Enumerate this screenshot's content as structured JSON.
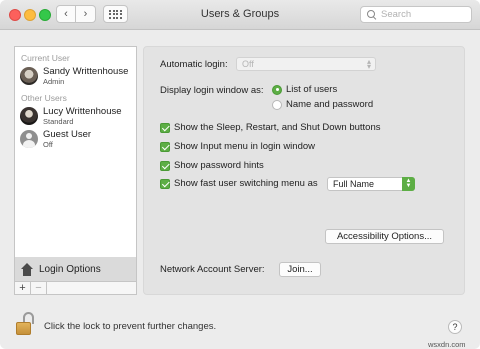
{
  "window": {
    "title": "Users & Groups"
  },
  "toolbar": {
    "back_glyph": "‹",
    "forward_glyph": "›"
  },
  "search": {
    "placeholder": "Search",
    "value": ""
  },
  "sidebar": {
    "current_header": "Current User",
    "other_header": "Other Users",
    "users": [
      {
        "name": "Sandy Writtenhouse",
        "role": "Admin",
        "avatar": "user-photo-avatar"
      },
      {
        "name": "Lucy Writtenhouse",
        "role": "Standard",
        "avatar": "user-photo-avatar"
      },
      {
        "name": "Guest User",
        "role": "Off",
        "avatar": "guest-silhouette-icon"
      }
    ],
    "login_options_label": "Login Options",
    "add_label": "+",
    "remove_label": "−"
  },
  "panel": {
    "auto_login_label": "Automatic login:",
    "auto_login_value": "Off",
    "display_login_label": "Display login window as:",
    "radio_list_label": "List of users",
    "radio_name_label": "Name and password",
    "radio_selected": "List of users",
    "check_sleep_label": "Show the Sleep, Restart, and Shut Down buttons",
    "check_input_label": "Show Input menu in login window",
    "check_hints_label": "Show password hints",
    "check_fast_label": "Show fast user switching menu as",
    "fast_switch_value": "Full Name",
    "accessibility_label": "Accessibility Options...",
    "network_label": "Network Account Server:",
    "join_label": "Join..."
  },
  "footer": {
    "lock_text": "Click the lock to prevent further changes.",
    "help_label": "?"
  },
  "watermark": "wsxdn.com",
  "colors": {
    "accent": "#5dae45",
    "selection": "#dadada"
  }
}
